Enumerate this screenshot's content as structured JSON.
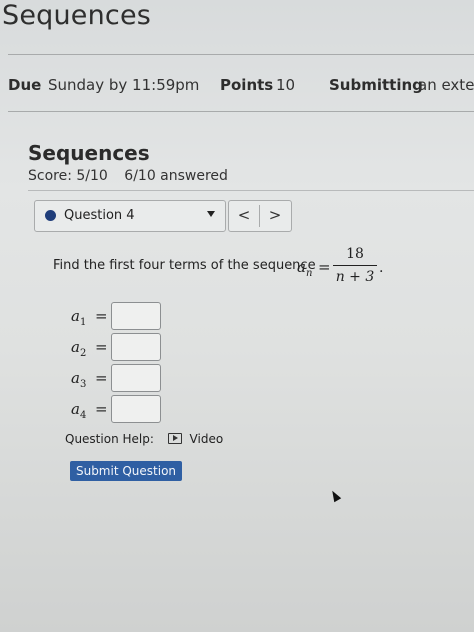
{
  "page": {
    "title": "Sequences"
  },
  "meta": {
    "due_label": "Due",
    "due_value": "Sunday by 11:59pm",
    "points_label": "Points",
    "points_value": "10",
    "submitting_label": "Submitting",
    "submitting_value": "an exter"
  },
  "assignment": {
    "title": "Sequences",
    "score": "Score: 5/10",
    "answered": "6/10 answered"
  },
  "question_nav": {
    "current": "Question 4",
    "prev_label": "<",
    "next_label": ">"
  },
  "question": {
    "prompt": "Find the first four terms of the sequence",
    "formula": {
      "lhs": "a",
      "lhs_sub": "n",
      "eq": "=",
      "numerator": "18",
      "denominator": "n + 3",
      "end": "."
    },
    "terms": [
      {
        "label": "a",
        "sub": "1",
        "eq": "=",
        "value": ""
      },
      {
        "label": "a",
        "sub": "2",
        "eq": "=",
        "value": ""
      },
      {
        "label": "a",
        "sub": "3",
        "eq": "=",
        "value": ""
      },
      {
        "label": "a",
        "sub": "4",
        "eq": "=",
        "value": ""
      }
    ]
  },
  "help": {
    "label": "Question Help:",
    "video": "Video"
  },
  "submit": {
    "label": "Submit Question"
  },
  "colors": {
    "accent": "#2f5fa3",
    "question_dot": "#1f3d7a"
  }
}
